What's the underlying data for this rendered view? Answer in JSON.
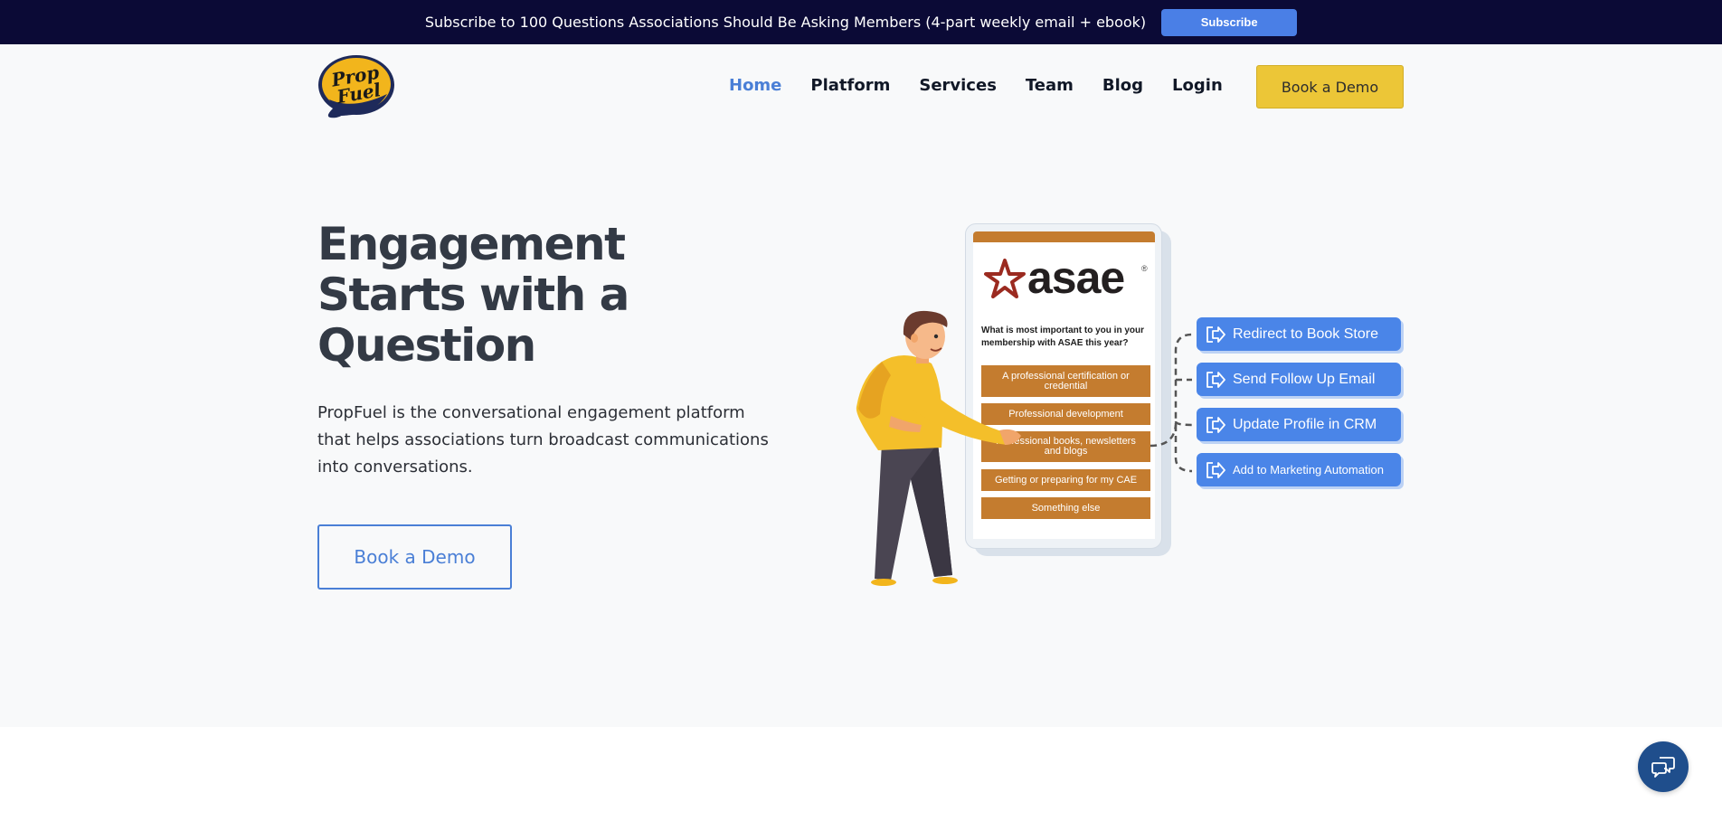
{
  "banner": {
    "text": "Subscribe to 100 Questions Associations Should Be Asking Members (4-part weekly email + ebook)",
    "button": "Subscribe"
  },
  "logo": {
    "text_line1": "Prop",
    "text_line2": "Fuel"
  },
  "nav": {
    "items": [
      "Home",
      "Platform",
      "Services",
      "Team",
      "Blog",
      "Login"
    ],
    "active": "Home",
    "cta": "Book a Demo"
  },
  "hero": {
    "headline_line1": "Engagement",
    "headline_line2": "Starts with a",
    "headline_line3": "Question",
    "subtext": "PropFuel is the conversational engagement platform that helps associations turn broadcast communications into conversations.",
    "cta": "Book a Demo"
  },
  "illustration": {
    "brand": "asae",
    "brand_reg": "®",
    "question": "What is most important to you in your membership with ASAE this year?",
    "options": [
      "A professional certification or credential",
      "Professional development",
      "Professional books, newsletters and blogs",
      "Getting or preparing for my CAE",
      "Something else"
    ],
    "actions": [
      "Redirect to Book Store",
      "Send Follow Up Email",
      "Update Profile in CRM",
      "Add to Marketing Automation"
    ]
  },
  "colors": {
    "banner_bg": "#0b0a36",
    "accent_blue": "#4a7fd6",
    "cta_yellow": "#ecc637",
    "option_orange": "#c47c2f",
    "chat_button": "#1f4e8c"
  },
  "icons": {
    "chat": "chat-bubbles-icon",
    "action": "redirect-arrow-icon"
  }
}
